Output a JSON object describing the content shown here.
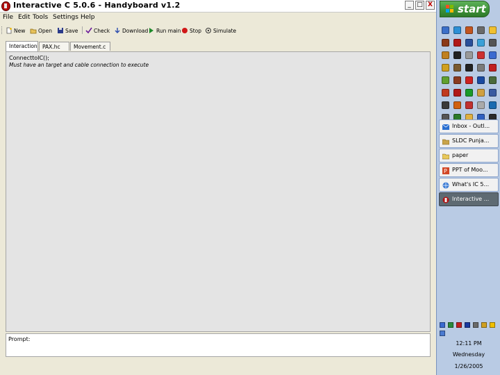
{
  "window": {
    "title": "Interactive C 5.0.6 - Handyboard v1.2",
    "minimize_glyph": "_",
    "maximize_glyph": "□",
    "close_glyph": "X"
  },
  "menu": [
    "File",
    "Edit",
    "Tools",
    "Settings",
    "Help"
  ],
  "toolbar": {
    "new": "New",
    "open": "Open",
    "save": "Save",
    "check": "Check",
    "download": "Download",
    "run_main": "Run main",
    "stop": "Stop",
    "simulate": "Simulate"
  },
  "tabs": [
    "Interaction",
    "PAX.hc",
    "Movement.c"
  ],
  "interaction": {
    "line1": "ConnecttoIC();",
    "line2": "Must have an target and cable connection to execute"
  },
  "prompt": {
    "label": "Prompt:"
  },
  "taskbar": {
    "start_label": "start",
    "tasks": [
      {
        "label": "Inbox - Outl...",
        "icon": "outlook-icon"
      },
      {
        "label": "SLDC Punja...",
        "icon": "folder-icon"
      },
      {
        "label": "paper",
        "icon": "folder-icon"
      },
      {
        "label": "PPT of Moo...",
        "icon": "powerpoint-icon"
      },
      {
        "label": "What's IC 5...",
        "icon": "browser-icon"
      },
      {
        "label": "Interactive ...",
        "icon": "ic-app-icon",
        "active": true
      }
    ],
    "clock": {
      "time": "12:11 PM",
      "day": "Wednesday",
      "date": "1/26/2005"
    }
  },
  "colors": {
    "taskbar_bg": "#b9cbe4",
    "start_green": "#3b8f35",
    "window_bg": "#ece9d8"
  }
}
